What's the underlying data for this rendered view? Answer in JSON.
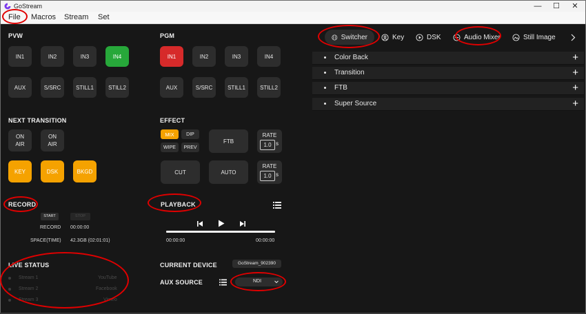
{
  "window": {
    "title": "GoStream",
    "controls": {
      "minimize": "—",
      "maximize": "☐",
      "close": "✕"
    }
  },
  "menubar": {
    "items": [
      "File",
      "Macros",
      "Stream",
      "Set"
    ]
  },
  "pvw": {
    "label": "PVW",
    "buttons": [
      "IN1",
      "IN2",
      "IN3",
      "IN4",
      "AUX",
      "S/SRC",
      "STILL1",
      "STILL2"
    ],
    "selected": "IN4"
  },
  "pgm": {
    "label": "PGM",
    "buttons": [
      "IN1",
      "IN2",
      "IN3",
      "IN4",
      "AUX",
      "S/SRC",
      "STILL1",
      "STILL2"
    ],
    "selected": "IN1"
  },
  "next_transition": {
    "label": "NEXT TRANSITION",
    "on_air": [
      "ON AIR",
      "ON AIR"
    ],
    "keys": [
      "KEY",
      "DSK",
      "BKGD"
    ]
  },
  "effect": {
    "label": "EFFECT",
    "types": [
      "MIX",
      "DIP",
      "WIPE",
      "PREV"
    ],
    "selected": "MIX",
    "ftb": "FTB",
    "cut": "CUT",
    "auto": "AUTO",
    "rate_label": "RATE",
    "rate1": "1.0",
    "rate2": "1.0",
    "rate_unit": "s"
  },
  "record": {
    "label": "RECORD",
    "start": "START",
    "stop": "STOP",
    "record_label": "RECORD",
    "record_time": "00:00:00",
    "space_label": "SPACE(TIME)",
    "space_value": "42.3GB (02:01:01)"
  },
  "playback": {
    "label": "PLAYBACK",
    "time_start": "00:00:00",
    "time_end": "00:00:00",
    "progress": 0
  },
  "live_status": {
    "label": "LIVE STATUS",
    "streams": [
      {
        "name": "Stream 1",
        "platform": "YouTube"
      },
      {
        "name": "Stream 2",
        "platform": "Facebook"
      },
      {
        "name": "Stream 3",
        "platform": "Vimeo"
      }
    ]
  },
  "device": {
    "current_label": "CURRENT DEVICE",
    "current_value": "GoStream_902390",
    "aux_label": "AUX SOURCE",
    "aux_value": "NDI"
  },
  "tabs": [
    "Switcher",
    "Key",
    "DSK",
    "Audio Mixer",
    "Still Image"
  ],
  "active_tab": "Switcher",
  "sections": [
    "Color Back",
    "Transition",
    "FTB",
    "Super Source"
  ],
  "colors": {
    "background": "#171717",
    "button": "#2d2d2d",
    "selected_pvw": "#27a83a",
    "selected_pgm": "#d62a2a",
    "accent_orange": "#f5a200",
    "annotation_red": "#e00000"
  }
}
